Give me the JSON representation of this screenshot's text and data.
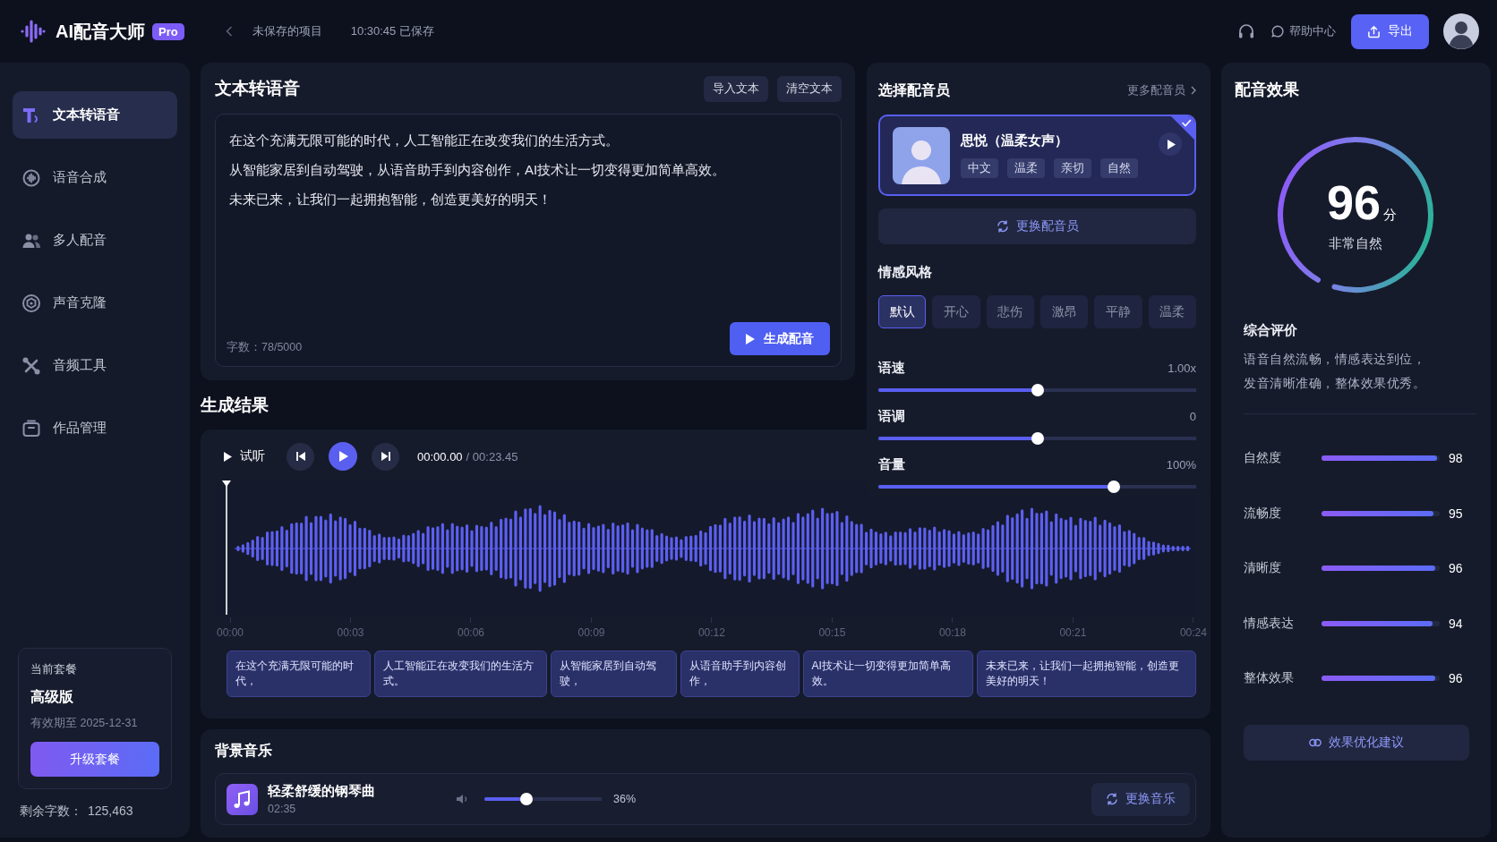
{
  "header": {
    "app_name": "AI配音大师",
    "badge": "Pro",
    "project": "未保存的项目",
    "saved": "10:30:45 已保存",
    "help": "帮助中心",
    "export": "导出"
  },
  "sidebar": {
    "items": [
      {
        "label": "文本转语音",
        "selected": true
      },
      {
        "label": "语音合成",
        "selected": false
      },
      {
        "label": "多人配音",
        "selected": false
      },
      {
        "label": "声音克隆",
        "selected": false
      },
      {
        "label": "音频工具",
        "selected": false
      },
      {
        "label": "作品管理",
        "selected": false
      }
    ],
    "plan": {
      "title": "当前套餐",
      "name": "高级版",
      "expiry": "有效期至 2025-12-31",
      "button": "升级套餐"
    },
    "quota": {
      "label": "剩余字数：",
      "value": "125,463"
    }
  },
  "editor": {
    "title": "文本转语音",
    "buttons": [
      "导入文本",
      "清空文本"
    ],
    "lines": [
      "在这个充满无限可能的时代，人工智能正在改变我们的生活方式。",
      "从智能家居到自动驾驶，从语音助手到内容创作，AI技术让一切变得更加简单高效。",
      "未来已来，让我们一起拥抱智能，创造更美好的明天！"
    ],
    "count": "字数：78/5000",
    "generate": "生成配音"
  },
  "result": {
    "title": "生成结果",
    "preview": "试听",
    "time": "00:00.00",
    "duration": "/ 00:23.45",
    "ticks": [
      "00:00",
      "00:03",
      "00:06",
      "00:09",
      "00:12",
      "00:15",
      "00:18",
      "00:21",
      "00:24"
    ],
    "captions": [
      "在这个充满无限可能的时代，",
      "人工智能正在改变我们的生活方式。",
      "从智能家居到自动驾驶，",
      "从语音助手到内容创作，",
      "AI技术让一切变得更加简单高效。",
      "未来已来，让我们一起拥抱智能，创造更美好的明天！"
    ]
  },
  "bgm": {
    "title": "背景音乐",
    "track": "轻柔舒缓的钢琴曲",
    "duration": "02:35",
    "volume": {
      "level": 0.36,
      "reading": "36%"
    },
    "change": "更换音乐"
  },
  "voice": {
    "title": "选择配音员",
    "more": "更多配音员",
    "card": {
      "name": "思悦（温柔女声）",
      "tags": [
        "中文",
        "温柔",
        "亲切",
        "自然"
      ],
      "selected": true
    },
    "change": "更换配音员",
    "emotion_title": "情感风格",
    "emotions": [
      {
        "label": "默认",
        "selected": true
      },
      {
        "label": "开心",
        "selected": false
      },
      {
        "label": "悲伤",
        "selected": false
      },
      {
        "label": "激昂",
        "selected": false
      },
      {
        "label": "平静",
        "selected": false
      },
      {
        "label": "温柔",
        "selected": false
      }
    ],
    "sliders": [
      {
        "label": "语速",
        "reading": "1.00x",
        "level": 0.5
      },
      {
        "label": "语调",
        "reading": "0",
        "level": 0.5
      },
      {
        "label": "音量",
        "reading": "100%",
        "level": 0.74
      }
    ]
  },
  "effect": {
    "title": "配音效果",
    "gauge": {
      "score": "96",
      "unit": "分",
      "caption": "非常自然",
      "level": 0.96
    },
    "summary_title": "综合评价",
    "summary": "语音自然流畅，情感表达到位，发音清晰准确，整体效果优秀。",
    "metrics": [
      {
        "label": "自然度",
        "value": "98",
        "level": 0.98
      },
      {
        "label": "流畅度",
        "value": "95",
        "level": 0.95
      },
      {
        "label": "清晰度",
        "value": "96",
        "level": 0.96
      },
      {
        "label": "情感表达",
        "value": "94",
        "level": 0.94
      },
      {
        "label": "整体效果",
        "value": "96",
        "level": 0.96
      }
    ],
    "advice": "效果优化建议"
  }
}
